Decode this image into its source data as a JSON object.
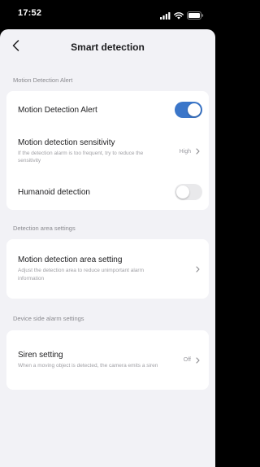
{
  "status_bar": {
    "time": "17:52",
    "icons": [
      "cellular-signal-icon",
      "wifi-icon",
      "battery-icon"
    ]
  },
  "nav": {
    "back_icon": "chevron-left-icon",
    "title": "Smart detection"
  },
  "sections": [
    {
      "header": "Motion Detection Alert",
      "rows": [
        {
          "title": "Motion Detection Alert",
          "control": "toggle",
          "enabled": true
        },
        {
          "title": "Motion detection sensitivity",
          "subtitle": "If the detection alarm is too frequent, try to reduce the sensitivity",
          "value": "High",
          "control": "chevron"
        },
        {
          "title": "Humanoid detection",
          "control": "toggle",
          "enabled": false
        }
      ]
    },
    {
      "header": "Detection area settings",
      "rows": [
        {
          "title": "Motion detection area setting",
          "subtitle": "Adjust the detection area to reduce unimportant alarm information",
          "control": "chevron"
        }
      ]
    },
    {
      "header": "Device side alarm settings",
      "rows": [
        {
          "title": "Siren setting",
          "subtitle": "When a moving object is detected, the camera emits a siren",
          "value": "Off",
          "control": "chevron"
        }
      ]
    }
  ],
  "colors": {
    "accent": "#3b76c9",
    "background": "#f2f2f6",
    "card": "#ffffff",
    "secondary_text": "#8a8a8f"
  }
}
